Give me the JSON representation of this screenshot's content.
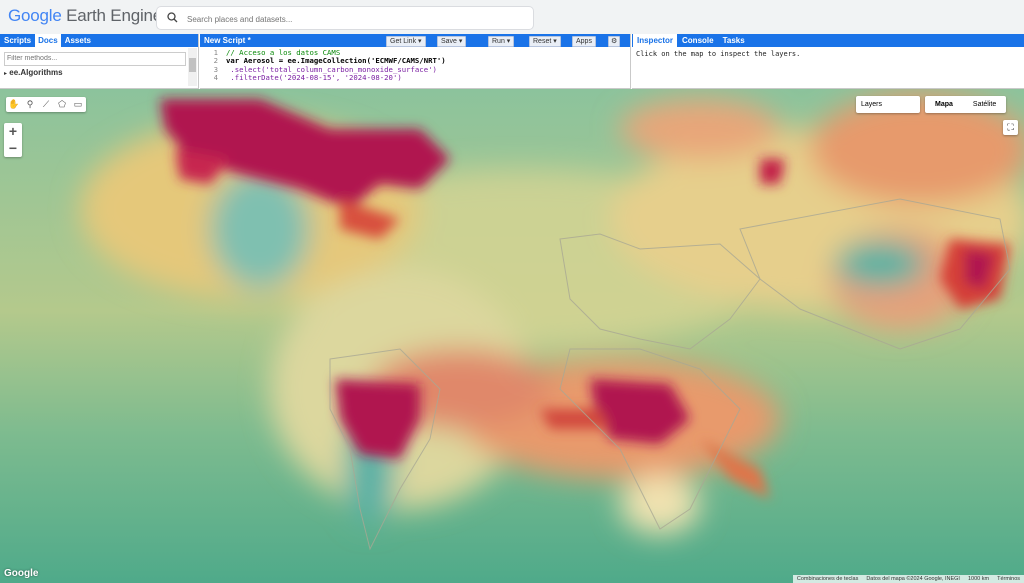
{
  "app": {
    "logo_google": "Google",
    "logo_product": "Earth Engine",
    "search_placeholder": "Search places and datasets..."
  },
  "left_panel": {
    "tabs": [
      "Scripts",
      "Docs",
      "Assets"
    ],
    "active_tab": "Docs",
    "filter_placeholder": "Filter methods...",
    "tree_item": "ee.Algorithms"
  },
  "editor": {
    "title": "New Script *",
    "buttons": [
      "Get Link",
      "Save",
      "Run",
      "Reset",
      "Apps"
    ],
    "lines": [
      {
        "n": "1",
        "text": "// Acceso a los datos CAMS"
      },
      {
        "n": "2",
        "text": "var Aerosol = ee.ImageCollection('ECMWF/CAMS/NRT')"
      },
      {
        "n": "3",
        "text": "  .select('total_column_carbon_monoxide_surface')"
      },
      {
        "n": "4",
        "text": "  .filterDate('2024-08-15', '2024-08-20')"
      }
    ]
  },
  "right_panel": {
    "tabs": [
      "Inspector",
      "Console",
      "Tasks"
    ],
    "active_tab": "Inspector",
    "message": "Click on the map to inspect the layers."
  },
  "map": {
    "layers_label": "Layers",
    "map_types": [
      "Mapa",
      "Satélite"
    ],
    "selected_map_type": "Mapa",
    "google_logo": "Google",
    "footer": [
      "Combinaciones de teclas",
      "Datos del mapa ©2024 Google, INEGI",
      "1000 km",
      "Términos"
    ],
    "colors": {
      "base": "#5fae88",
      "low": "#4fb3a4",
      "mid": "#e8d79a",
      "high": "#e0744a",
      "max": "#b0144f"
    }
  }
}
